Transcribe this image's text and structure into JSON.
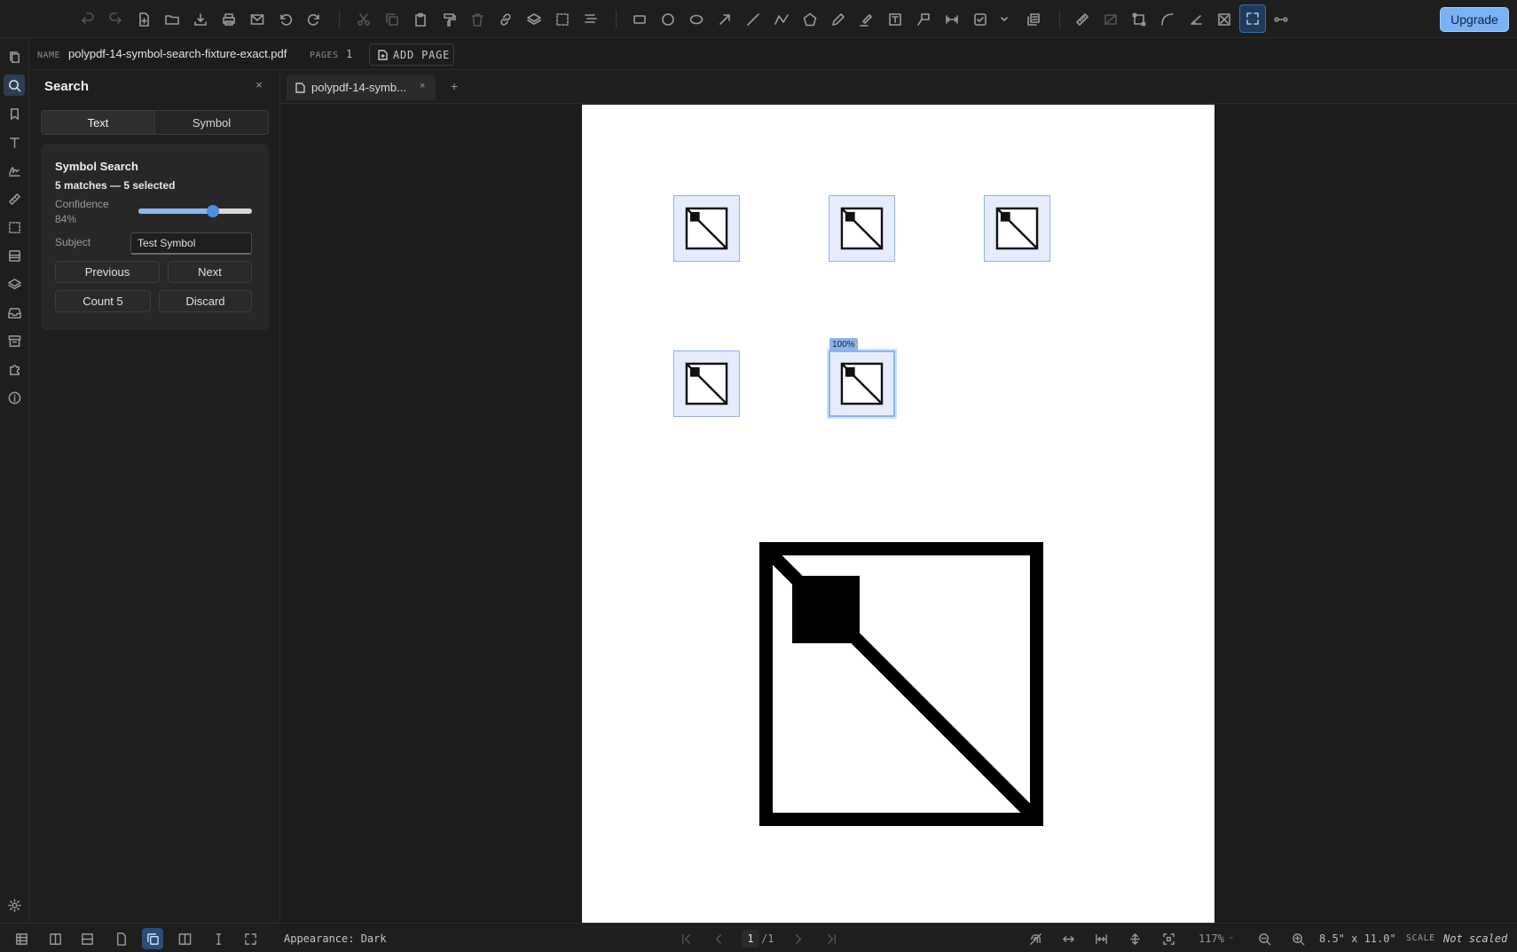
{
  "toolbar": {
    "upgrade_label": "Upgrade",
    "icons": [
      "undo-icon",
      "redo-icon",
      "new-file-icon",
      "open-folder-icon",
      "download-icon",
      "print-icon",
      "email-icon",
      "rotate-left-icon",
      "rotate-right-icon",
      "cut-icon",
      "copy-icon",
      "paste-icon",
      "format-painter-icon",
      "delete-icon",
      "link-icon",
      "layers-icon",
      "select-area-icon",
      "align-icon",
      "rectangle-icon",
      "circle-icon",
      "ellipse-icon",
      "arrow-icon",
      "line-icon",
      "polyline-icon",
      "polygon-icon",
      "pen-icon",
      "highlighter-icon",
      "text-box-icon",
      "callout-icon",
      "dimension-icon",
      "checkbox-icon",
      "dropdown-chevron-icon",
      "stamp-icon",
      "ruler-icon",
      "area-measure-icon",
      "perimeter-icon",
      "arc-icon",
      "angle-icon",
      "count-icon",
      "fullscreen-capture-icon",
      "distance-icon"
    ]
  },
  "rail": {
    "icons": [
      "pages-icon",
      "search-icon",
      "bookmark-icon",
      "text-icon",
      "signature-icon",
      "measure-icon",
      "selection-icon",
      "forms-icon",
      "layers-icon",
      "inbox-icon",
      "archive-icon",
      "puzzle-icon",
      "info-icon",
      "settings-icon"
    ]
  },
  "document": {
    "name_key": "NAME",
    "name": "polypdf-14-symbol-search-fixture-exact.pdf",
    "pages_key": "PAGES",
    "pages": "1",
    "add_page_label": "ADD PAGE"
  },
  "search_panel": {
    "title": "Search",
    "close_glyph": "×",
    "tabs": [
      {
        "label": "Text",
        "selected": false
      },
      {
        "label": "Symbol",
        "selected": true
      }
    ],
    "card": {
      "title": "Symbol Search",
      "matches_text": "5 matches — 5 selected",
      "confidence_label": "Confidence",
      "confidence_value": "84%",
      "confidence_fraction": 0.66,
      "subject_label": "Subject",
      "subject_value": "Test Symbol",
      "previous_label": "Previous",
      "next_label": "Next",
      "count_label": "Count 5",
      "discard_label": "Discard"
    }
  },
  "tabs": {
    "doc_tab_label": "polypdf-14-symb...",
    "close_glyph": "×",
    "new_tab_glyph": "+"
  },
  "canvas": {
    "matches": [
      {
        "selected": false
      },
      {
        "selected": false
      },
      {
        "selected": false
      },
      {
        "selected": false
      },
      {
        "selected": true,
        "badge": "100%"
      }
    ],
    "colors": {
      "match_fill": "#e6ecfb",
      "match_border": "#8eb2ec",
      "accent": "#7ab2f5"
    }
  },
  "statusbar": {
    "appearance_text": "Appearance: Dark",
    "current_page": "1",
    "page_total": "/1",
    "zoom_level": "117%",
    "zoom_caret": "⌄",
    "page_size": "8.5\" x 11.0\"",
    "scale_key": "SCALE",
    "scale_value": "Not scaled"
  }
}
